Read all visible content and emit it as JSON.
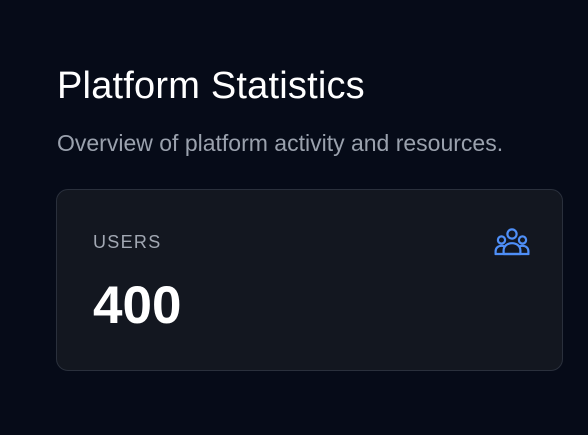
{
  "header": {
    "title": "Platform Statistics",
    "subtitle": "Overview of platform activity and resources."
  },
  "stats": [
    {
      "label": "USERS",
      "value": "400",
      "icon": "users-icon",
      "icon_color": "#4f8ff7"
    }
  ],
  "colors": {
    "background": "#060b18",
    "card_background": "#131720",
    "card_border": "#2a303c",
    "accent": "#4f8ff7"
  }
}
